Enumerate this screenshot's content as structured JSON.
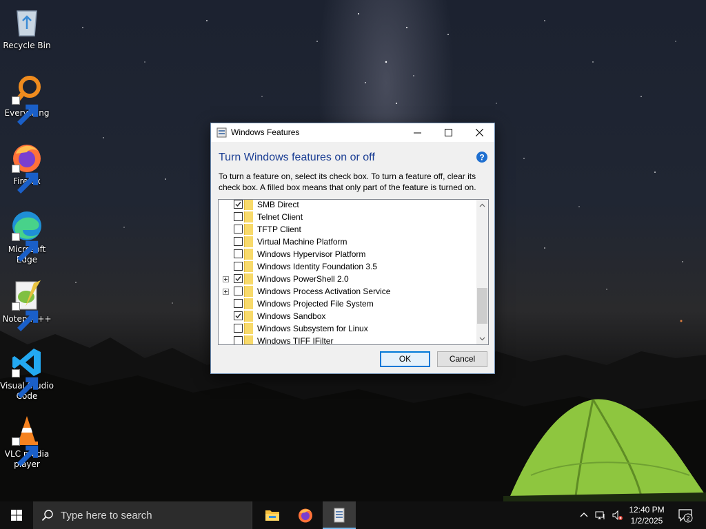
{
  "desktop": {
    "icons": [
      {
        "label": "Recycle Bin"
      },
      {
        "label": "Everything"
      },
      {
        "label": "Firefox"
      },
      {
        "label": "Microsoft Edge"
      },
      {
        "label": "Notepad++"
      },
      {
        "label": "Visual Studio Code"
      },
      {
        "label": "VLC media player"
      }
    ]
  },
  "dialog": {
    "title": "Windows Features",
    "heading": "Turn Windows features on or off",
    "description": "To turn a feature on, select its check box. To turn a feature off, clear its check box. A filled box means that only part of the feature is turned on.",
    "features": [
      {
        "label": "SMB Direct",
        "checked": true,
        "expandable": false
      },
      {
        "label": "Telnet Client",
        "checked": false,
        "expandable": false
      },
      {
        "label": "TFTP Client",
        "checked": false,
        "expandable": false
      },
      {
        "label": "Virtual Machine Platform",
        "checked": false,
        "expandable": false
      },
      {
        "label": "Windows Hypervisor Platform",
        "checked": false,
        "expandable": false
      },
      {
        "label": "Windows Identity Foundation 3.5",
        "checked": false,
        "expandable": false
      },
      {
        "label": "Windows PowerShell 2.0",
        "checked": true,
        "expandable": true
      },
      {
        "label": "Windows Process Activation Service",
        "checked": false,
        "expandable": true
      },
      {
        "label": "Windows Projected File System",
        "checked": false,
        "expandable": false
      },
      {
        "label": "Windows Sandbox",
        "checked": true,
        "expandable": false
      },
      {
        "label": "Windows Subsystem for Linux",
        "checked": false,
        "expandable": false
      },
      {
        "label": "Windows TIFF IFilter",
        "checked": false,
        "expandable": false
      }
    ],
    "ok_label": "OK",
    "cancel_label": "Cancel"
  },
  "taskbar": {
    "search_placeholder": "Type here to search",
    "time": "12:40 PM",
    "date": "1/2/2025",
    "notification_count": "2"
  },
  "colors": {
    "heading": "#1c3f94",
    "accent": "#0078d7",
    "taskbar": "#101010"
  }
}
